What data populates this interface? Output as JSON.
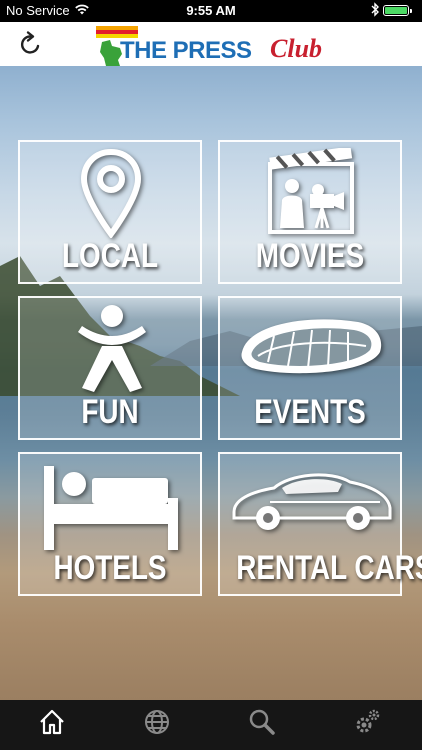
{
  "status_bar": {
    "carrier": "No Service",
    "time": "9:55 AM",
    "battery_level": 1.0
  },
  "header": {
    "refresh_icon": "refresh-icon",
    "logo": {
      "word1": "THE PRESS",
      "word2": "Club"
    }
  },
  "tiles": [
    {
      "label": "LOCAL",
      "icon": "map-pin-icon"
    },
    {
      "label": "MOVIES",
      "icon": "movie-camera-icon"
    },
    {
      "label": "FUN",
      "icon": "person-jumping-icon"
    },
    {
      "label": "EVENTS",
      "icon": "stadium-icon"
    },
    {
      "label": "HOTELS",
      "icon": "bed-icon"
    },
    {
      "label": "RENTAL CARS",
      "icon": "car-icon"
    }
  ],
  "tab_bar": {
    "items": [
      {
        "icon": "home-icon",
        "active": true
      },
      {
        "icon": "globe-icon",
        "active": false
      },
      {
        "icon": "search-icon",
        "active": false
      },
      {
        "icon": "settings-gears-icon",
        "active": false
      }
    ],
    "active_color": "#ffffff",
    "inactive_color": "#8a8a8a"
  }
}
